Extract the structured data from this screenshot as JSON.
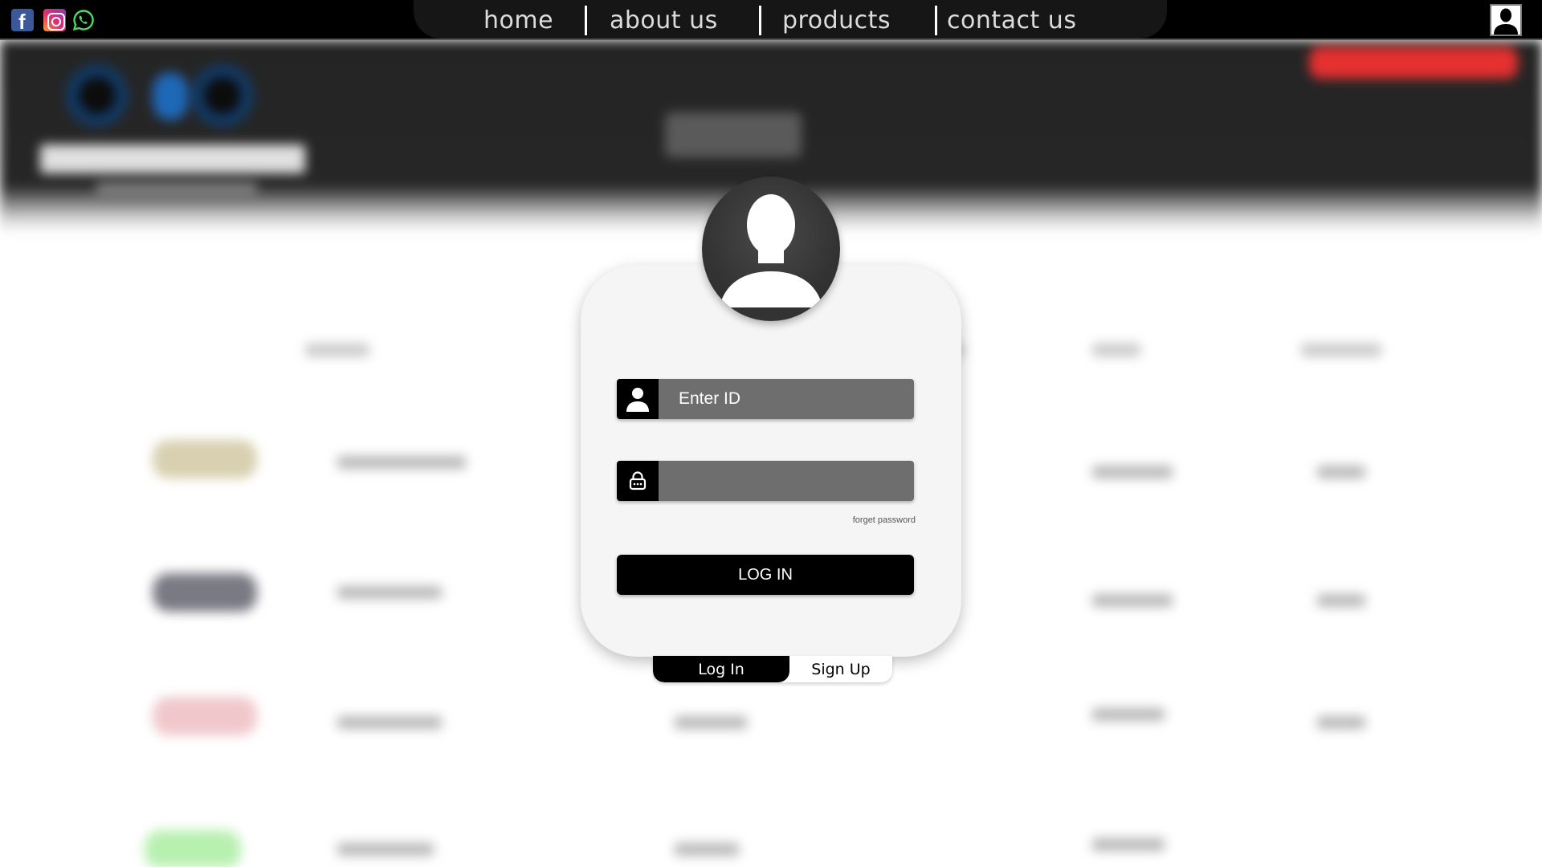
{
  "social": {
    "facebook_icon": "facebook-icon",
    "instagram_icon": "instagram-icon",
    "whatsapp_icon": "whatsapp-icon"
  },
  "nav": {
    "items": [
      {
        "label": "home"
      },
      {
        "label": "about us"
      },
      {
        "label": "products"
      },
      {
        "label": "contact us"
      }
    ],
    "account_icon": "user-icon"
  },
  "login": {
    "id_placeholder": "Enter ID",
    "password_placeholder": "",
    "forget_password": "forget password",
    "login_button": "LOG IN",
    "tabs": {
      "login": "Log In",
      "signup": "Sign Up"
    }
  },
  "colors": {
    "navbar_bg": "#000000",
    "card_bg": "#f5f5f5",
    "field_bg": "#6e6e6e",
    "button_bg": "#000000",
    "accent_red": "#e53030"
  }
}
